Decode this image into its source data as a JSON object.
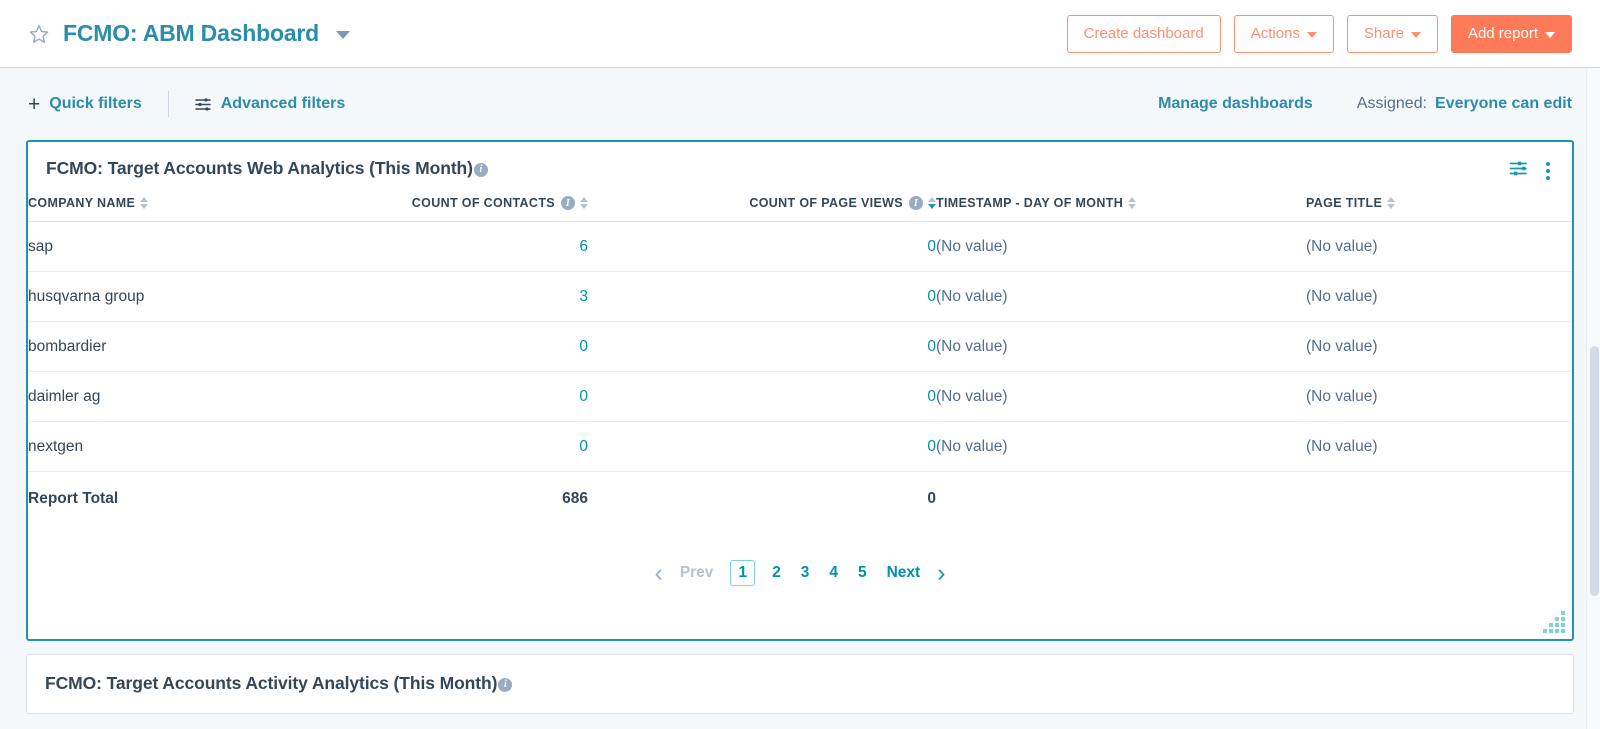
{
  "header": {
    "star_icon": "star-outline-icon",
    "title": "FCMO: ABM Dashboard",
    "dropdown_icon": "chevron-down-icon",
    "buttons": [
      {
        "label": "Create dashboard",
        "style": "secondary",
        "caret": false
      },
      {
        "label": "Actions",
        "style": "secondary",
        "caret": true
      },
      {
        "label": "Share",
        "style": "secondary",
        "caret": true
      },
      {
        "label": "Add report",
        "style": "primary",
        "caret": true
      }
    ]
  },
  "filter_bar": {
    "quick_filters_label": "Quick filters",
    "quick_filters_icon": "plus-icon",
    "advanced_filters_label": "Advanced filters",
    "advanced_filters_icon": "tune-sliders-icon",
    "manage_dashboards_label": "Manage dashboards",
    "assigned_label": "Assigned:",
    "assigned_value": "Everyone can edit"
  },
  "report_card": {
    "title": "FCMO: Target Accounts Web Analytics (This Month)",
    "info_icon": "info-circle-icon",
    "settings_icon": "tune-sliders-icon",
    "menu_icon": "kebab-menu-icon",
    "resize_icon": "resize-grip-icon",
    "columns": [
      {
        "label": "COMPANY NAME",
        "has_info": false,
        "sort": "none",
        "align": "left"
      },
      {
        "label": "COUNT OF CONTACTS",
        "has_info": true,
        "sort": "none",
        "align": "right"
      },
      {
        "label": "COUNT OF PAGE VIEWS",
        "has_info": true,
        "sort": "desc",
        "align": "right"
      },
      {
        "label": "TIMESTAMP - DAY OF MONTH",
        "has_info": false,
        "sort": "none",
        "align": "left"
      },
      {
        "label": "PAGE TITLE",
        "has_info": false,
        "sort": "none",
        "align": "left"
      }
    ],
    "rows": [
      {
        "company": "sap",
        "contacts": "6",
        "page_views": "0",
        "timestamp": "(No value)",
        "page_title": "(No value)"
      },
      {
        "company": "husqvarna group",
        "contacts": "3",
        "page_views": "0",
        "timestamp": "(No value)",
        "page_title": "(No value)"
      },
      {
        "company": "bombardier",
        "contacts": "0",
        "page_views": "0",
        "timestamp": "(No value)",
        "page_title": "(No value)"
      },
      {
        "company": "daimler ag",
        "contacts": "0",
        "page_views": "0",
        "timestamp": "(No value)",
        "page_title": "(No value)"
      },
      {
        "company": "nextgen",
        "contacts": "0",
        "page_views": "0",
        "timestamp": "(No value)",
        "page_title": "(No value)"
      }
    ],
    "total_row": {
      "label": "Report Total",
      "contacts": "686",
      "page_views": "0",
      "timestamp": "",
      "page_title": ""
    },
    "pagination": {
      "prev_chevron": "chevron-left-icon",
      "prev_label": "Prev",
      "pages": [
        "1",
        "2",
        "3",
        "4",
        "5"
      ],
      "current_page": "1",
      "next_label": "Next",
      "next_chevron": "chevron-right-icon"
    }
  },
  "second_card": {
    "title": "FCMO: Target Accounts Activity Analytics (This Month)",
    "info_icon": "info-circle-icon"
  },
  "colors": {
    "brand_teal": "#2a8daa",
    "link_teal": "#0091ae",
    "accent_orange": "#ff7a59",
    "accent_orange_light": "#ff8f73",
    "text_dark": "#33475b",
    "text_muted": "#516f90",
    "page_bg": "#f5f8fa",
    "card_border_active": "#1d94b3"
  }
}
